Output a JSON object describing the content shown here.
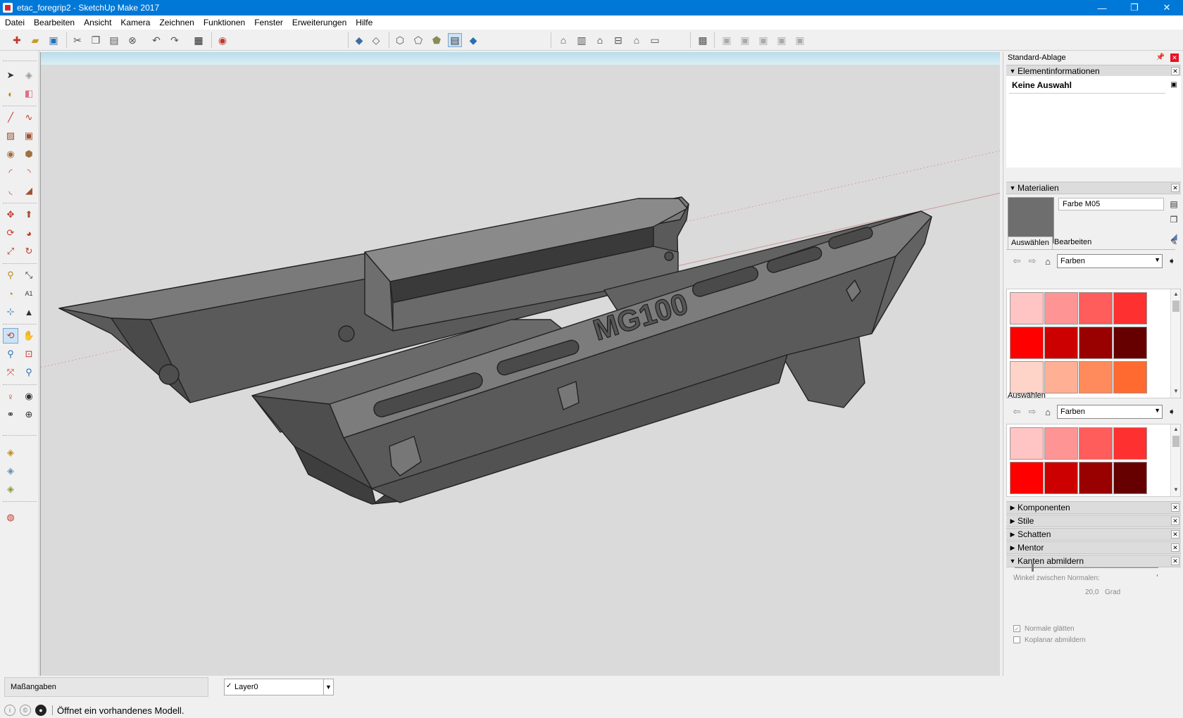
{
  "window": {
    "title": "etac_foregrip2 - SketchUp Make 2017",
    "minimize": "—",
    "restore": "❐",
    "close": "✕"
  },
  "menu": [
    "Datei",
    "Bearbeiten",
    "Ansicht",
    "Kamera",
    "Zeichnen",
    "Funktionen",
    "Fenster",
    "Erweiterungen",
    "Hilfe"
  ],
  "toolbar_icons": [
    "new-icon",
    "open-icon",
    "save-icon",
    "cut-icon",
    "copy-icon",
    "paste-icon",
    "erase-icon",
    "undo-icon",
    "redo-icon",
    "print-icon",
    "model-info-icon",
    "xray-icon",
    "back-edges-icon",
    "wireframe-icon",
    "hidden-line-icon",
    "shaded-icon",
    "shaded-textures-icon",
    "monochrome-icon",
    "iso-view-icon",
    "top-view-icon",
    "front-view-icon",
    "right-view-icon",
    "back-view-icon",
    "left-view-icon",
    "section-icon",
    "union-icon",
    "subtract-icon",
    "intersect-icon",
    "trim-icon",
    "split-icon"
  ],
  "left_tools": [
    "select-icon",
    "make-component-icon",
    "paint-bucket-icon",
    "eraser-icon",
    "line-icon",
    "freehand-icon",
    "rectangle-icon",
    "rotated-rect-icon",
    "circle-icon",
    "polygon-icon",
    "arc-icon",
    "two-point-arc-icon",
    "three-point-arc-icon",
    "pie-icon",
    "move-icon",
    "push-pull-icon",
    "rotate-icon",
    "follow-me-icon",
    "scale-icon",
    "offset-icon",
    "tape-measure-icon",
    "dimension-icon",
    "protractor-icon",
    "text-icon",
    "axes-icon",
    "3d-text-icon",
    "orbit-icon",
    "pan-icon",
    "zoom-icon",
    "zoom-window-icon",
    "zoom-extents-icon",
    "previous-view-icon",
    "position-camera-icon",
    "look-around-icon",
    "walk-icon",
    "section-plane-icon",
    "warehouse-icon",
    "extension-warehouse-icon",
    "share-model-icon",
    "ruby-icon"
  ],
  "model": {
    "label": "MG100"
  },
  "tray": {
    "title": "Standard-Ablage",
    "pin": "📌",
    "close": "✕",
    "entity_info": {
      "header": "Elementinformationen",
      "value": "Keine Auswahl"
    },
    "materials": {
      "header": "Materialien",
      "name": "Farbe M05",
      "swatch_color": "#6e6e6e",
      "tab_select": "Auswählen",
      "tab_edit": "Bearbeiten",
      "library": "Farben",
      "colors": [
        "#ffc4c4",
        "#ff9494",
        "#ff5c5c",
        "#ff3030",
        "#ff0000",
        "#cc0000",
        "#990000",
        "#660000",
        "#ffd4c8",
        "#ffb094",
        "#ff8a5c",
        "#ff6a30"
      ]
    },
    "secondary": {
      "label": "Auswählen",
      "library": "Farben",
      "colors": [
        "#ffc4c4",
        "#ff9494",
        "#ff5c5c",
        "#ff3030",
        "#ff0000",
        "#cc0000",
        "#990000",
        "#660000"
      ]
    },
    "collapsed": [
      "Komponenten",
      "Stile",
      "Schatten",
      "Mentor"
    ],
    "soften": {
      "header": "Kanten abmildern",
      "angle_label": "Winkel zwischen Normalen:",
      "angle_value": "20,0",
      "angle_unit": "Grad",
      "angle_fraction": 0.12,
      "smooth_normals": "Normale glätten",
      "soften_coplanar": "Koplanar abmildern"
    }
  },
  "bottom": {
    "measurements_label": "Maßangaben",
    "layer": "Layer0"
  },
  "status": {
    "text": "Öffnet ein vorhandenes Modell."
  }
}
